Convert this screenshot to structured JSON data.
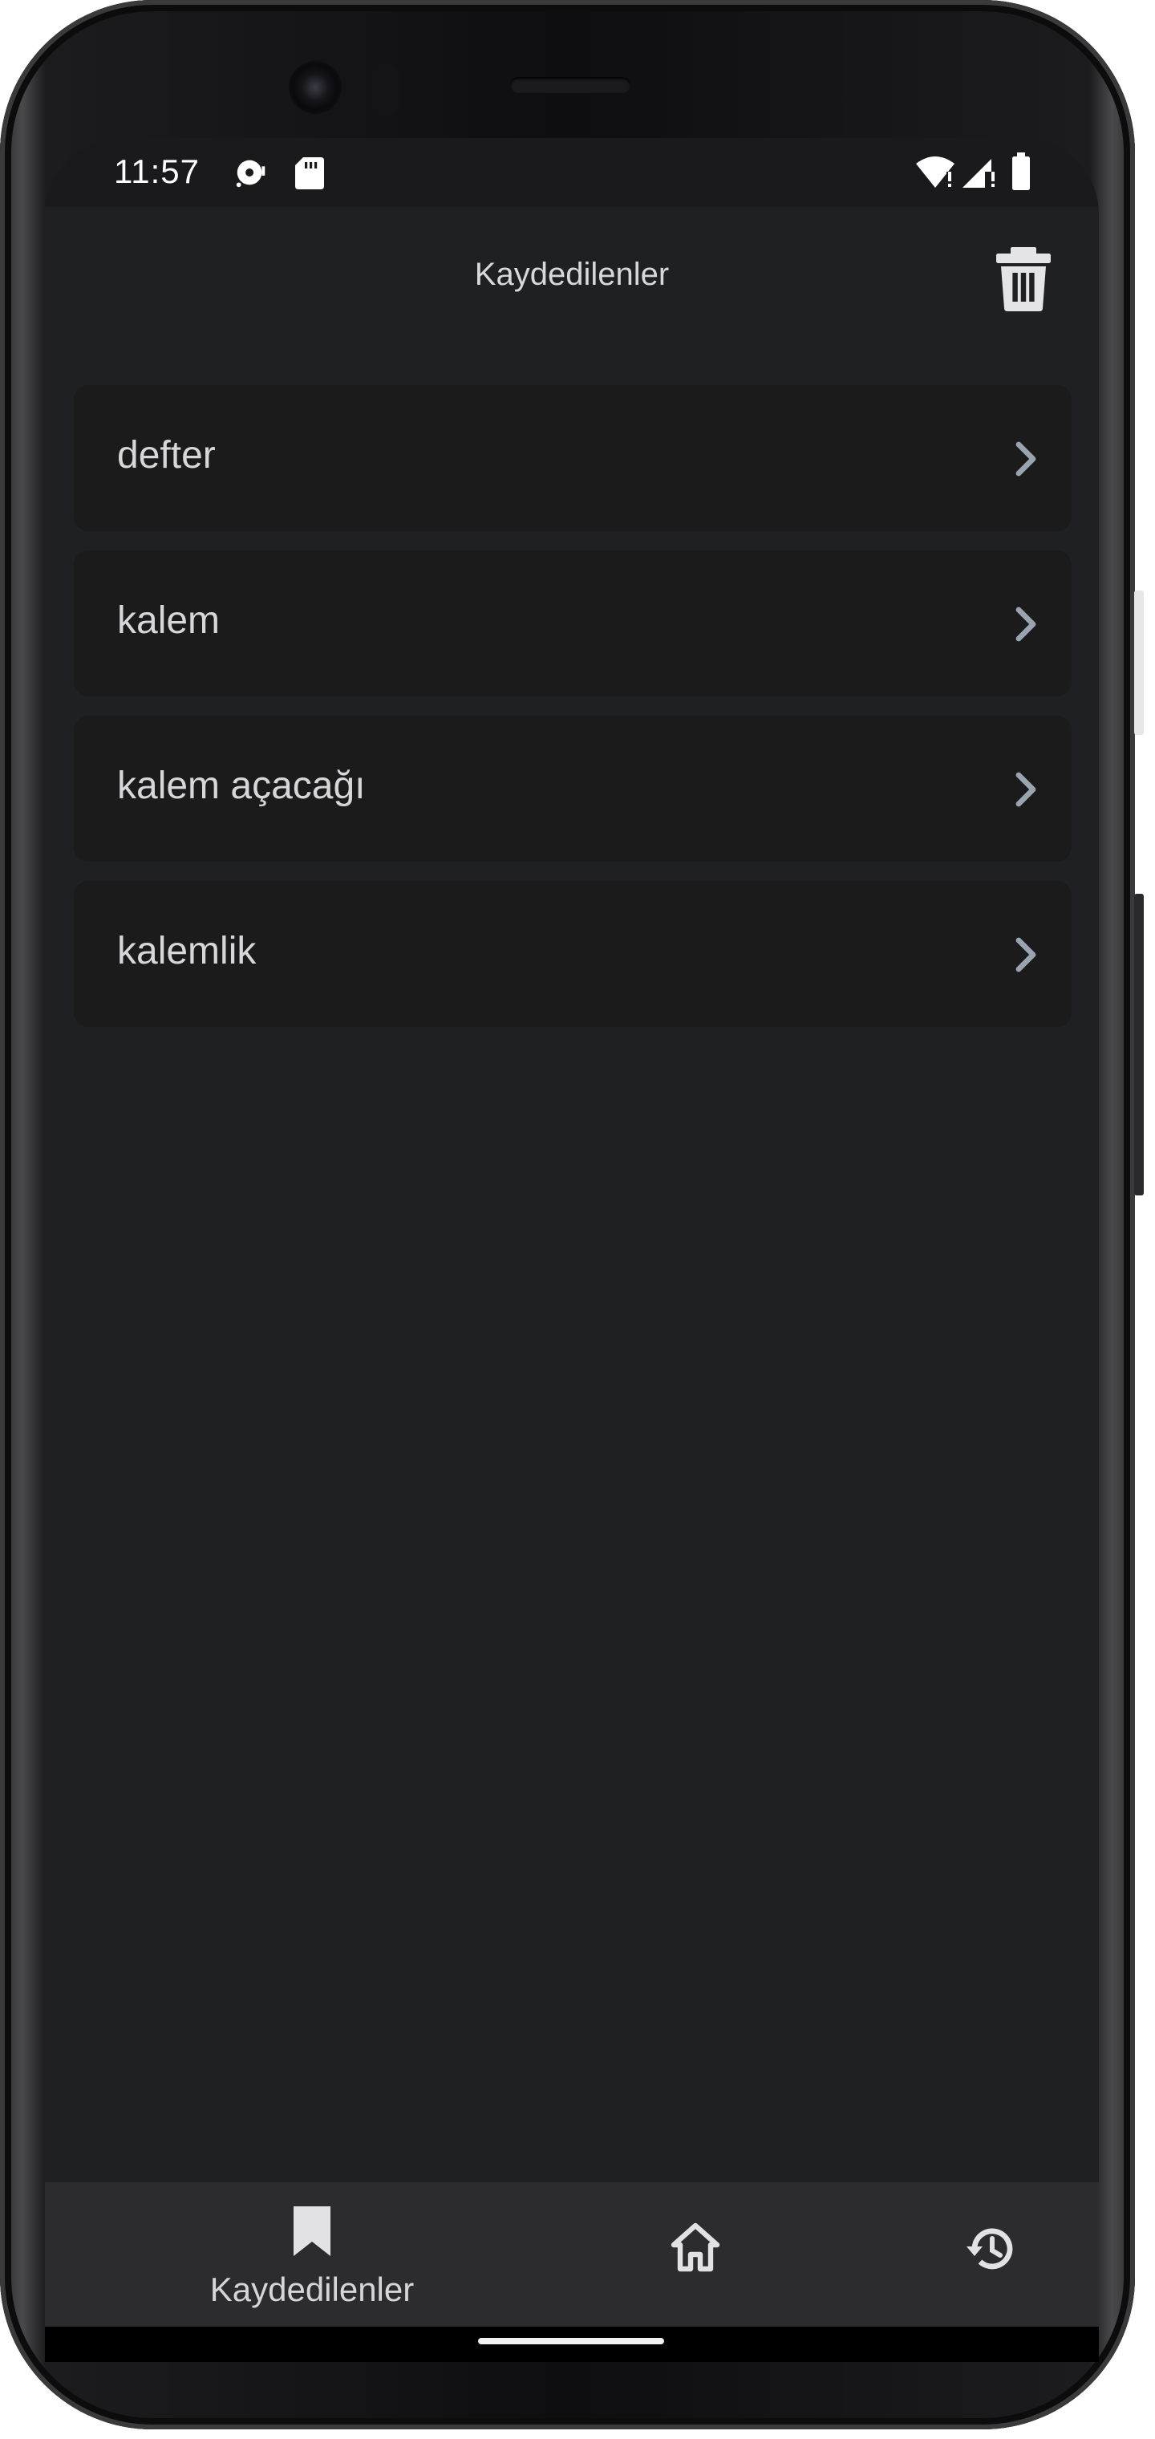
{
  "status_bar": {
    "time": "11:57",
    "left_icons": [
      "media-sync-icon",
      "sd-card-icon"
    ],
    "right_icons": [
      "wifi-icon",
      "cell-signal-icon",
      "battery-icon"
    ]
  },
  "app_bar": {
    "title": "Kaydedilenler",
    "action_icon": "trash-icon"
  },
  "saved_list": {
    "items": [
      {
        "label": "defter"
      },
      {
        "label": "kalem"
      },
      {
        "label": "kalem açacağı"
      },
      {
        "label": "kalemlik"
      }
    ],
    "item_trailing_icon": "chevron-right-icon"
  },
  "bottom_nav": {
    "items": [
      {
        "icon": "bookmark-icon",
        "label": "Kaydedilenler",
        "selected": true
      },
      {
        "icon": "home-icon",
        "label": "",
        "selected": false
      },
      {
        "icon": "history-icon",
        "label": "",
        "selected": false
      }
    ]
  },
  "colors": {
    "background": "#1f2023",
    "list_item_background": "#1b1b1c",
    "bottom_nav_background": "#2c2c2e",
    "text_primary": "#d7d7da",
    "chevron": "#9aa3b0"
  }
}
